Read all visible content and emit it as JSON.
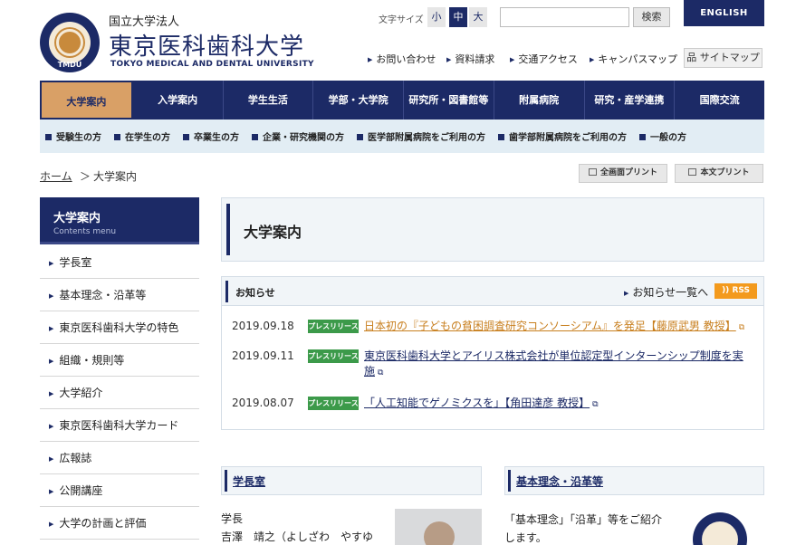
{
  "header": {
    "corp": "国立大学法人",
    "name": "東京医科歯科大学",
    "name_en": "TOKYO MEDICAL AND DENTAL UNIVERSITY",
    "logo_abbr": "TMDU",
    "font_size_label": "文字サイズ",
    "font_sizes": [
      "小",
      "中",
      "大"
    ],
    "search_button": "検索",
    "english": "ENGLISH",
    "util_links": [
      "お問い合わせ",
      "資料請求",
      "交通アクセス",
      "キャンパスマップ"
    ],
    "sitemap": "サイトマップ"
  },
  "global_nav": [
    "大学案内",
    "入学案内",
    "学生生活",
    "学部・大学院",
    "研究所・図書館等",
    "附属病院",
    "研究・産学連携",
    "国際交流"
  ],
  "sub_nav": [
    "受験生の方",
    "在学生の方",
    "卒業生の方",
    "企業・研究機関の方",
    "医学部附属病院をご利用の方",
    "歯学部附属病院をご利用の方",
    "一般の方"
  ],
  "breadcrumb": {
    "home": "ホーム",
    "sep": "＞",
    "current": "大学案内"
  },
  "print": {
    "full": "全画面プリント",
    "body": "本文プリント"
  },
  "side": {
    "title": "大学案内",
    "subtitle": "Contents menu",
    "items": [
      "学長室",
      "基本理念・沿革等",
      "東京医科歯科大学の特色",
      "組織・規則等",
      "大学紹介",
      "東京医科歯科大学カード",
      "広報誌",
      "公開講座",
      "大学の計画と評価"
    ]
  },
  "page_title": "大学案内",
  "news": {
    "title": "お知らせ",
    "more": "お知らせ一覧へ",
    "rss": "RSS",
    "items": [
      {
        "date": "2019.09.18",
        "badge": "プレスリリース",
        "text": "日本初の『子どもの貧困調査研究コンソーシアム』を発足【藤原武男 教授】",
        "color": "#c87f1f"
      },
      {
        "date": "2019.09.11",
        "badge": "プレスリリース",
        "text": "東京医科歯科大学とアイリス株式会社が単位認定型インターンシップ制度を実施",
        "color": "#1c2a66"
      },
      {
        "date": "2019.08.07",
        "badge": "プレスリリース",
        "text": "「人工知能でゲノミクスを」【角田達彦 教授】",
        "color": "#1c2a66"
      }
    ]
  },
  "cards": {
    "president": {
      "title": "学長室",
      "role": "学長",
      "name": "吉澤　靖之（よしざわ　やすゆ"
    },
    "philosophy": {
      "title": "基本理念・沿革等",
      "text": "「基本理念」「沿革」等をご紹介します。"
    }
  }
}
